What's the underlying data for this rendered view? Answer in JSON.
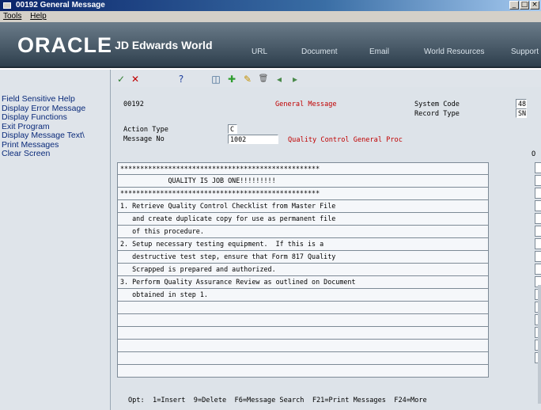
{
  "window": {
    "title": "00192   General Message",
    "controls": [
      "_",
      "□",
      "×"
    ]
  },
  "menu": {
    "items": [
      "Tools",
      "Help"
    ]
  },
  "banner": {
    "logo_oracle": "ORACLE",
    "logo_product": "JD Edwards World",
    "nav": [
      "URL",
      "Document",
      "Email",
      "World Resources",
      "Support"
    ]
  },
  "exits": [
    "Field Sensitive Help",
    "Display Error Message",
    "Display Functions",
    "Exit Program",
    "Display Message Text\\",
    "Print Messages",
    "Clear Screen"
  ],
  "toolbar": {
    "icons": [
      "check-icon",
      "cancel-icon",
      "help-icon",
      "inquire-icon",
      "add-icon",
      "change-icon",
      "delete-icon",
      "previous-icon",
      "next-icon"
    ],
    "glyphs": [
      "✓",
      "✕",
      "?",
      "◫",
      "✚",
      "✎",
      "🗑",
      "◂",
      "▸"
    ]
  },
  "form": {
    "program_id": "00192",
    "screen_title": "General Message",
    "system_code_label": "System Code",
    "system_code_value": "48",
    "record_type_label": "Record Type",
    "record_type_value": "SN",
    "action_type_label": "Action Type",
    "action_type_value": "C",
    "message_no_label": "Message No",
    "message_no_value": "1002",
    "message_description": "Quality Control General Proc",
    "opt_header": "O"
  },
  "message_lines": [
    "**************************************************",
    "            QUALITY IS JOB ONE!!!!!!!!!",
    "**************************************************",
    "1. Retrieve Quality Control Checklist from Master File",
    "   and create duplicate copy for use as permanent file",
    "   of this procedure.",
    "2. Setup necessary testing equipment.  If this is a",
    "   destructive test step, ensure that Form 817 Quality",
    "   Scrapped is prepared and authorized.",
    "3. Perform Quality Assurance Review as outlined on Document",
    "   obtained in step 1.",
    "",
    "",
    "",
    "",
    "",
    ""
  ],
  "footer": "Opt:  1=Insert  9=Delete  F6=Message Search  F21=Print Messages  F24=More"
}
